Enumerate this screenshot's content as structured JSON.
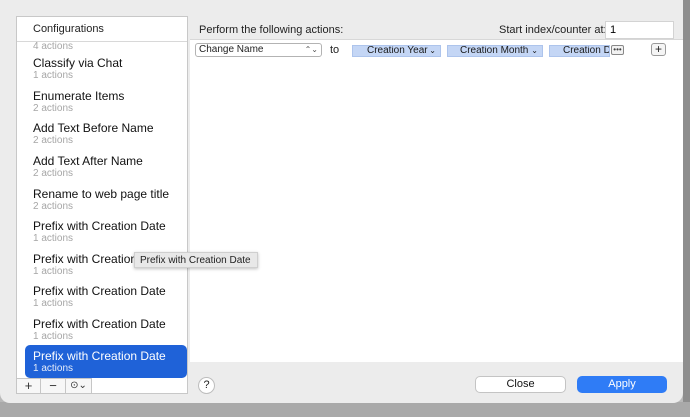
{
  "sidebar": {
    "header": "Configurations",
    "items": [
      {
        "name": "",
        "count": "4 actions"
      },
      {
        "name": "Classify via Chat",
        "count": "1 actions"
      },
      {
        "name": "Enumerate Items",
        "count": "2 actions"
      },
      {
        "name": "Add Text Before Name",
        "count": "2 actions"
      },
      {
        "name": "Add Text After Name",
        "count": "2 actions"
      },
      {
        "name": "Rename to web page title",
        "count": "2 actions"
      },
      {
        "name": "Prefix with Creation Date",
        "count": "1 actions"
      },
      {
        "name": "Prefix with Creation",
        "count": "1 actions"
      },
      {
        "name": "Prefix with Creation Date",
        "count": "1 actions"
      },
      {
        "name": "Prefix with Creation Date",
        "count": "1 actions"
      },
      {
        "name": "Prefix with Creation Date",
        "count": "1 actions"
      }
    ],
    "footer": {
      "add": "+",
      "remove": "−",
      "menu": "⊙⌄"
    }
  },
  "main": {
    "perform_label": "Perform the following actions:",
    "start_label": "Start index/counter at:",
    "start_value": "1",
    "action_select": "Change Name",
    "to_label": "to",
    "tokens": [
      "Creation Year",
      "Creation Month",
      "Creation D"
    ],
    "add_row": "+"
  },
  "tooltip": "Prefix with Creation Date",
  "buttons": {
    "help": "?",
    "close": "Close",
    "apply": "Apply"
  },
  "colors": {
    "selection": "#1f62d8",
    "token": "#c4d6f5",
    "apply": "#2f7cf6"
  },
  "icons": {
    "more": "ellipsis-icon",
    "chevron": "chevron-down-icon"
  }
}
